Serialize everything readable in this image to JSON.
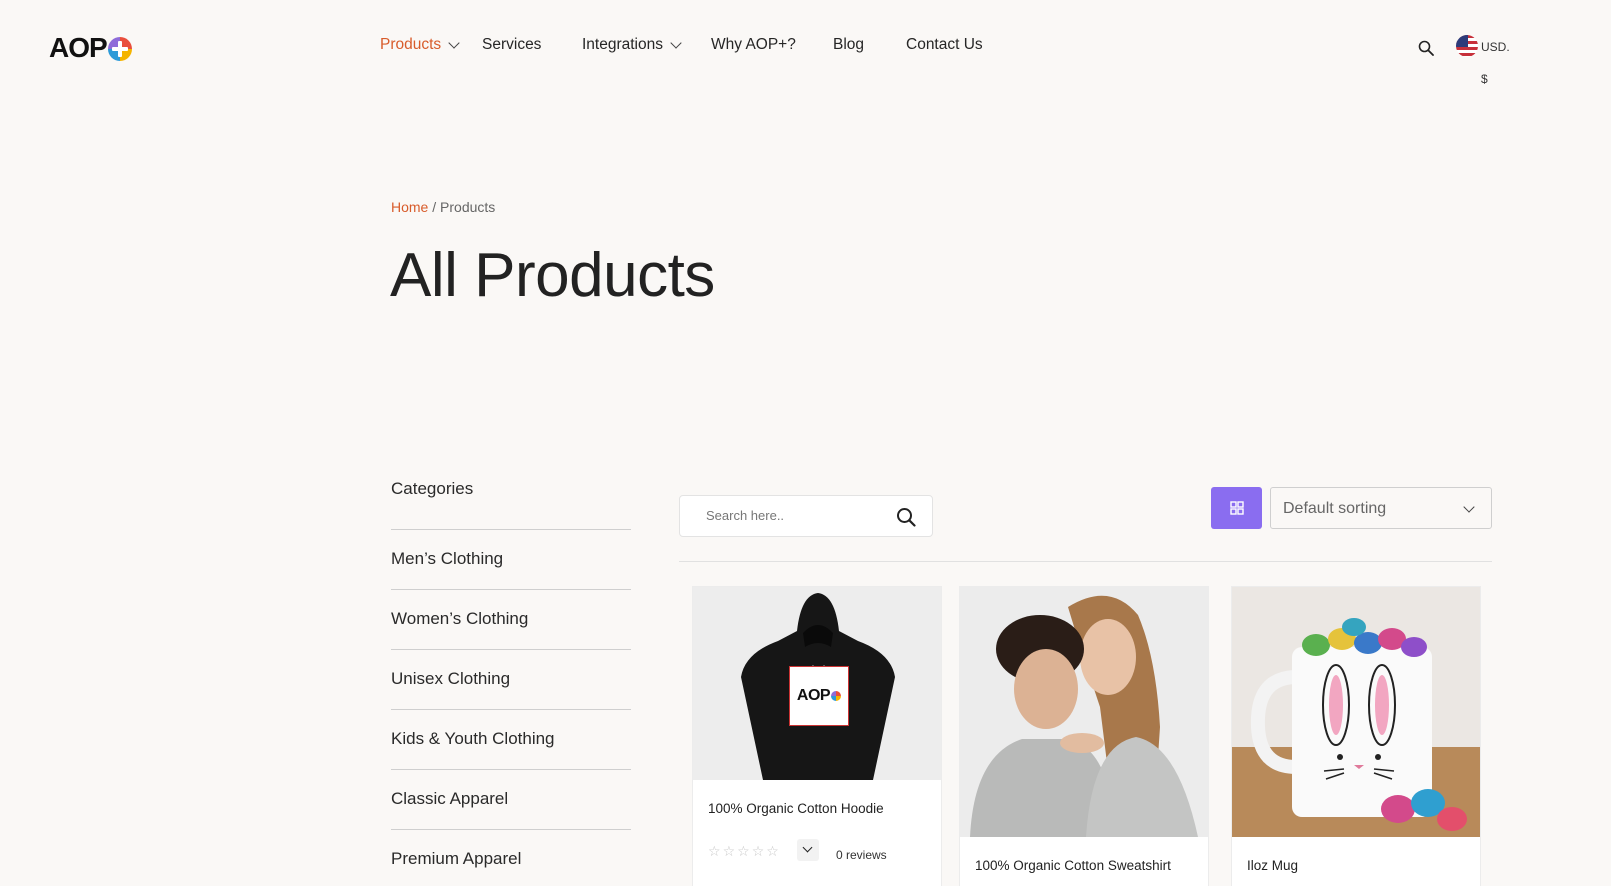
{
  "brand": {
    "logo_text": "AOP"
  },
  "nav": {
    "items": [
      {
        "label": "Products",
        "active": true,
        "dropdown": true
      },
      {
        "label": "Services",
        "active": false,
        "dropdown": false
      },
      {
        "label": "Integrations",
        "active": false,
        "dropdown": true
      },
      {
        "label": "Why AOP+?",
        "active": false,
        "dropdown": false
      },
      {
        "label": "Blog",
        "active": false,
        "dropdown": false
      },
      {
        "label": "Contact Us",
        "active": false,
        "dropdown": false
      }
    ],
    "search_icon": "search-icon"
  },
  "currency": {
    "code": "USD.",
    "symbol": "$",
    "flag": "us-flag-icon"
  },
  "breadcrumb": {
    "home": "Home",
    "separator": "/",
    "current": "Products"
  },
  "page": {
    "title": "All Products"
  },
  "sidebar": {
    "heading": "Categories",
    "categories": [
      "Men’s Clothing",
      "Women’s Clothing",
      "Unisex Clothing",
      "Kids & Youth Clothing",
      "Classic Apparel",
      "Premium Apparel"
    ]
  },
  "toolbar": {
    "search_placeholder": "Search here..",
    "view_icon": "grid-view-icon",
    "sort_selected": "Default sorting"
  },
  "products": [
    {
      "name": "100% Organic Cotton Hoodie",
      "rating": 0,
      "max_rating": 5,
      "reviews": "0 reviews",
      "print_text": "AOP"
    },
    {
      "name": "100% Organic Cotton Sweatshirt"
    },
    {
      "name": "Iloz Mug"
    }
  ],
  "colors": {
    "accent_orange": "#d85c2b",
    "accent_purple": "#8a6df0",
    "background": "#faf8f6"
  }
}
